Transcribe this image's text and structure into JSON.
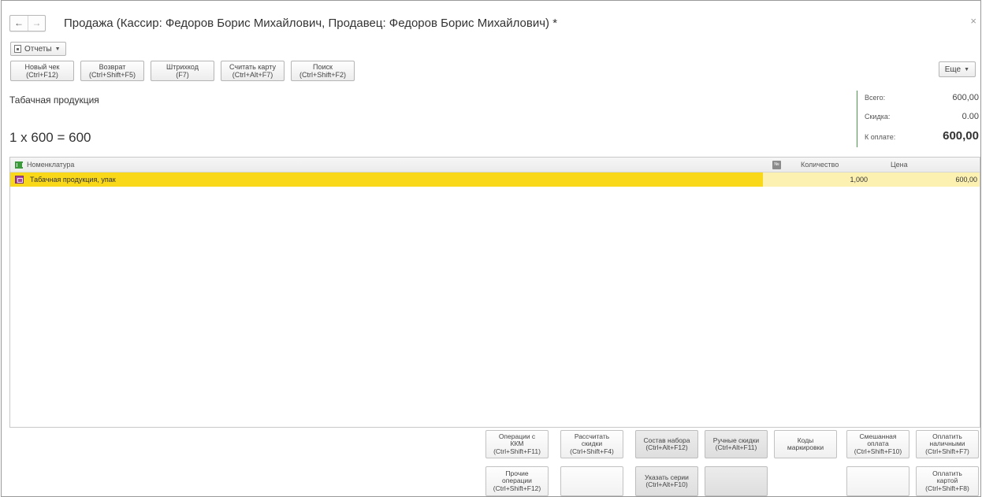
{
  "window": {
    "back_icon": "arrow-left-icon",
    "forward_icon": "arrow-right-icon",
    "title": "Продажа (Кассир: Федоров Борис Михайлович, Продавец: Федоров Борис Михайлович) *",
    "close": "×"
  },
  "reports": {
    "label": "Отчеты"
  },
  "toolbar": {
    "buttons": [
      {
        "line1": "Новый чек",
        "line2": "(Ctrl+F12)"
      },
      {
        "line1": "Возврат",
        "line2": "(Ctrl+Shift+F5)"
      },
      {
        "line1": "Штрихкод",
        "line2": "(F7)"
      },
      {
        "line1": "Считать карту",
        "line2": "(Ctrl+Alt+F7)"
      },
      {
        "line1": "Поиск",
        "line2": "(Ctrl+Shift+F2)"
      }
    ],
    "more_label": "Еще"
  },
  "current_item": {
    "name": "Табачная продукция",
    "calc": "1 x 600 = 600"
  },
  "totals": {
    "total_label": "Всего:",
    "total_value": "600,00",
    "discount_label": "Скидка:",
    "discount_value": "0.00",
    "payable_label": "К оплате:",
    "payable_value": "600,00"
  },
  "table": {
    "columns": {
      "nomenclature": "Номенклатура",
      "number": "№",
      "quantity": "Количество",
      "price": "Цена"
    },
    "rows": [
      {
        "name": "Табачная продукция, упак",
        "quantity": "1,000",
        "price": "600,00"
      }
    ],
    "highlight_color": "#f9d719"
  },
  "actions": {
    "kkm_ops": [
      "Операции с",
      "ККМ",
      "(Ctrl+Shift+F11)"
    ],
    "calc_discounts": [
      "Рассчитать",
      "скидки",
      "(Ctrl+Shift+F4)"
    ],
    "set_contents": [
      "Состав набора",
      "(Ctrl+Alt+F12)"
    ],
    "manual_discounts": [
      "Ручные скидки",
      "(Ctrl+Alt+F11)"
    ],
    "marking_codes": [
      "Коды",
      "маркировки"
    ],
    "mixed_payment": [
      "Смешанная",
      "оплата",
      "(Ctrl+Shift+F10)"
    ],
    "pay_cash": [
      "Оплатить",
      "наличными",
      "(Ctrl+Shift+F7)"
    ],
    "other_ops": [
      "Прочие",
      "операции",
      "(Ctrl+Shift+F12)"
    ],
    "specify_series": [
      "Указать серии",
      "(Ctrl+Alt+F10)"
    ],
    "pay_card": [
      "Оплатить",
      "картой",
      "(Ctrl+Shift+F8)"
    ]
  }
}
